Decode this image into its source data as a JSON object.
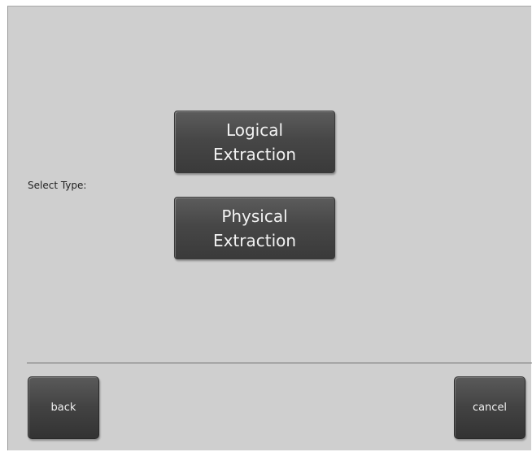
{
  "screen": {
    "select_label": "Select Type:"
  },
  "options": {
    "logical_label": "Logical\nExtraction",
    "physical_label": "Physical\nExtraction"
  },
  "footer": {
    "back_label": "back",
    "cancel_label": "cancel"
  },
  "colors": {
    "background": "#cfcfcf",
    "button": "#474747",
    "button_text": "#f2f2f2"
  }
}
